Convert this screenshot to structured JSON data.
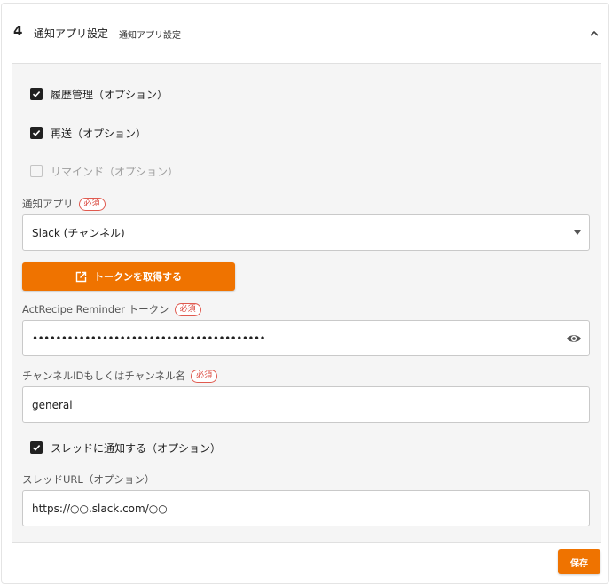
{
  "step": {
    "number": "4",
    "title": "通知アプリ設定",
    "subtitle": "通知アプリ設定"
  },
  "options": {
    "history": {
      "label": "履歴管理（オプション）",
      "checked": true
    },
    "resend": {
      "label": "再送（オプション）",
      "checked": true
    },
    "remind": {
      "label": "リマインド（オプション）",
      "checked": false,
      "disabled": true
    }
  },
  "notify_app": {
    "label": "通知アプリ",
    "required": "必須",
    "value": "Slack (チャンネル)"
  },
  "token_button": {
    "label": "トークンを取得する"
  },
  "token": {
    "label": "ActRecipe Reminder トークン",
    "required": "必須",
    "value": "••••••••••••••••••••••••••••••••••••••••"
  },
  "channel": {
    "label": "チャンネルIDもしくはチャンネル名",
    "required": "必須",
    "value": "general"
  },
  "thread_option": {
    "label": "スレッドに通知する（オプション）",
    "checked": true
  },
  "thread_url": {
    "label": "スレッドURL（オプション）",
    "value": "https://○○.slack.com/○○"
  },
  "save_button": {
    "label": "保存"
  },
  "colors": {
    "accent": "#ef7300",
    "required": "#d9443a",
    "panel": "#f5f5f5"
  }
}
